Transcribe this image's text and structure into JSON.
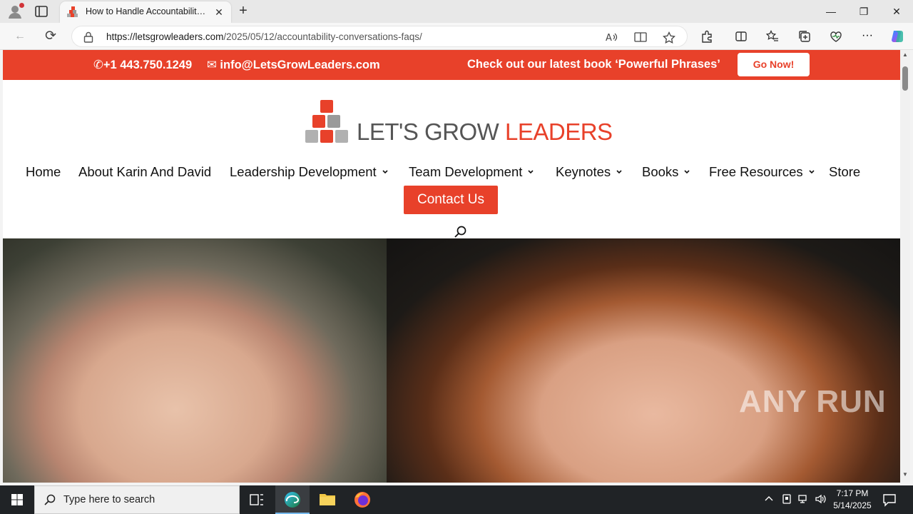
{
  "browser": {
    "tab_title": "How to Handle Accountability Conversations FAQs",
    "url_host": "https://letsgrowleaders.com",
    "url_path": "/2025/05/12/accountability-conversations-faqs/",
    "tab_close": "✕",
    "new_tab": "+",
    "back": "←",
    "refresh": "⟳",
    "minimize": "—",
    "restore": "❐",
    "close": "✕",
    "more": "···"
  },
  "topbar": {
    "phone": "+1 443.750.1249",
    "email": "info@LetsGrowLeaders.com",
    "promo": "Check out our latest book ‘Powerful Phrases’",
    "go_now": "Go Now!",
    "color": "#e8412a"
  },
  "logo": {
    "part1": "LET'S GROW",
    "part2": "LEADERS"
  },
  "nav": {
    "items": [
      {
        "label": "Home"
      },
      {
        "label": "About Karin And David"
      },
      {
        "label": "Leadership Development"
      },
      {
        "label": "Team Development"
      },
      {
        "label": "Keynotes"
      },
      {
        "label": "Books"
      },
      {
        "label": "Free Resources"
      },
      {
        "label": "Store"
      }
    ],
    "contact": "Contact Us"
  },
  "watermark": "ANY RUN",
  "taskbar": {
    "search_placeholder": "Type here to search",
    "time": "7:17 PM",
    "date": "5/14/2025"
  },
  "icons": {
    "profile": "profile-icon",
    "tabs": "tab-actions-icon",
    "lock": "lock-icon",
    "read_aloud": "read-aloud-icon",
    "immersive": "immersive-reader-icon",
    "favorite": "favorite-star-icon",
    "extensions": "extensions-icon",
    "split": "split-screen-icon",
    "favorites": "favorites-icon",
    "collections": "collections-icon",
    "performance": "browser-essentials-icon",
    "copilot": "copilot-icon",
    "search": "search-icon"
  }
}
